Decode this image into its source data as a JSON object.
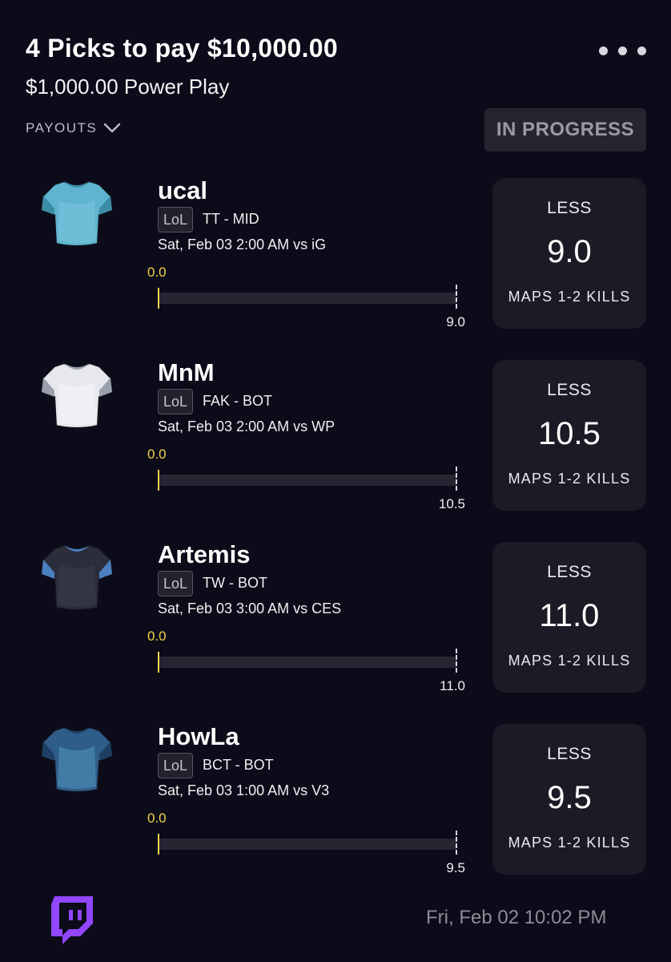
{
  "header": {
    "title": "4 Picks to pay $10,000.00",
    "subtitle": "$1,000.00 Power Play",
    "payouts_label": "PAYOUTS",
    "status": "IN PROGRESS"
  },
  "picks": [
    {
      "player": "ucal",
      "league": "LoL",
      "team": "TT - MID",
      "time": "Sat, Feb 03 2:00 AM  vs iG",
      "current": "0.0",
      "target": "9.0",
      "progress": 0,
      "direction": "LESS",
      "line": "9.0",
      "stat": "MAPS 1-2 KILLS",
      "jersey": {
        "primary": "#5fb4cf",
        "secondary": "#8fd1e4",
        "trim": "#3d8ca6"
      }
    },
    {
      "player": "MnM",
      "league": "LoL",
      "team": "FAK - BOT",
      "time": "Sat, Feb 03 2:00 AM  vs WP",
      "current": "0.0",
      "target": "10.5",
      "progress": 0,
      "direction": "LESS",
      "line": "10.5",
      "stat": "MAPS 1-2 KILLS",
      "jersey": {
        "primary": "#e6e8ee",
        "secondary": "#ffffff",
        "trim": "#9aa0ab"
      }
    },
    {
      "player": "Artemis",
      "league": "LoL",
      "team": "TW - BOT",
      "time": "Sat, Feb 03 3:00 AM  vs CES",
      "current": "0.0",
      "target": "11.0",
      "progress": 0,
      "direction": "LESS",
      "line": "11.0",
      "stat": "MAPS 1-2 KILLS",
      "jersey": {
        "primary": "#2b2e3a",
        "secondary": "#3e4456",
        "trim": "#4a7fc0"
      }
    },
    {
      "player": "HowLa",
      "league": "LoL",
      "team": "BCT - BOT",
      "time": "Sat, Feb 03 1:00 AM  vs V3",
      "current": "0.0",
      "target": "9.5",
      "progress": 0,
      "direction": "LESS",
      "line": "9.5",
      "stat": "MAPS 1-2 KILLS",
      "jersey": {
        "primary": "#2f5d8a",
        "secondary": "#67b7da",
        "trim": "#1e3f63"
      }
    }
  ],
  "footer": {
    "timestamp": "Fri, Feb 02 10:02 PM",
    "icon": "twitch-icon",
    "icon_color": "#9146ff"
  }
}
